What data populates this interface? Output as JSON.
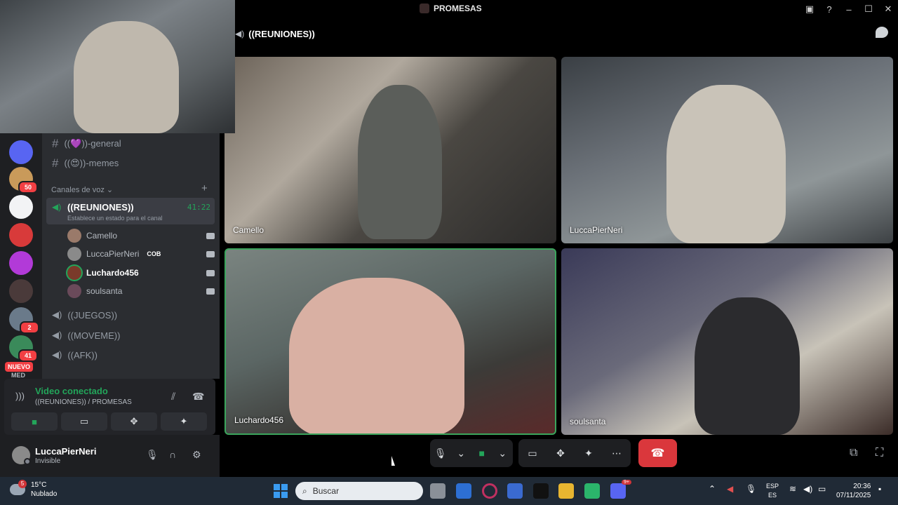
{
  "window": {
    "title": "PROMESAS"
  },
  "channel_header": {
    "name": "((REUNIONES))"
  },
  "tiles": [
    {
      "name": "Camello"
    },
    {
      "name": "LuccaPierNeri"
    },
    {
      "name": "Luchardo456"
    },
    {
      "name": "soulsanta"
    }
  ],
  "server_rail": {
    "badges": [
      "50",
      "2",
      "41"
    ],
    "nuevo": "NUEVO",
    "partial_label": "MED"
  },
  "channels": {
    "text": [
      {
        "label": "((💜))-general"
      },
      {
        "label": "((😍))-memes"
      }
    ],
    "voice_category": "Canales de voz",
    "active_voice": {
      "name": "((REUNIONES))",
      "timer": "41:22",
      "status": "Establece un estado para el canal"
    },
    "members": [
      {
        "name": "Camello",
        "badge": ""
      },
      {
        "name": "LuccaPierNeri",
        "badge": "COB"
      },
      {
        "name": "Luchardo456",
        "badge": ""
      },
      {
        "name": "soulsanta",
        "badge": ""
      }
    ],
    "voice": [
      {
        "label": "((JUEGOS))"
      },
      {
        "label": "((MOVEME))"
      },
      {
        "label": "((AFK))"
      }
    ]
  },
  "voice_panel": {
    "title": "Video conectado",
    "subtitle": "((REUNIONES)) / PROMESAS"
  },
  "user": {
    "name": "LuccaPierNeri",
    "status": "Invisible"
  },
  "taskbar": {
    "temperature": "15°C",
    "weather": "Nublado",
    "weather_badge": "5",
    "search_placeholder": "Buscar",
    "discord_badge": "9+",
    "lang1": "ESP",
    "lang2": "ES",
    "time": "20:36",
    "date": "07/11/2025"
  }
}
